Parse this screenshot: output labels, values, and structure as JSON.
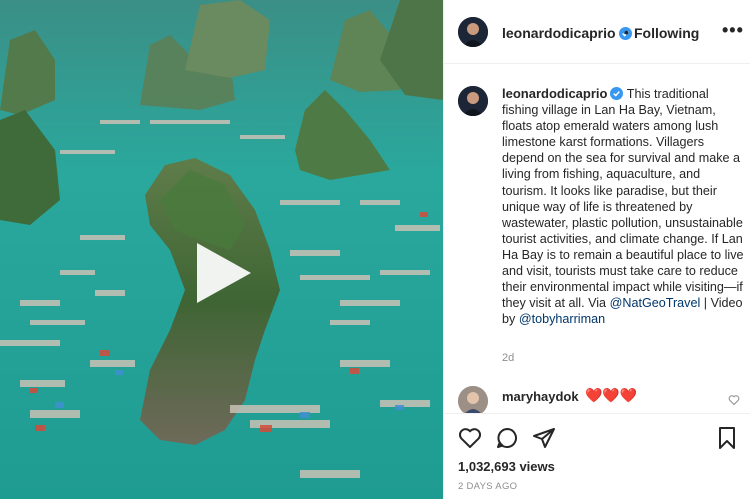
{
  "post": {
    "username": "leonardodicaprio",
    "follow_status": "Following",
    "separator": "•",
    "more_label": "•••",
    "caption": {
      "username": "leonardodicaprio",
      "text": "This traditional fishing village in Lan Ha Bay, Vietnam, floats atop emerald waters among lush limestone karst formations. Villagers depend on the sea for survival and make a living from fishing, aquaculture, and tourism. It looks like paradise, but their unique way of life is threatened by wastewater, plastic pollution, unsustainable tourist activities, and climate change. If Lan Ha Bay is to remain a beautiful place to live and visit, tourists must take care to reduce their environmental impact while visiting—if they visit at all. Via",
      "mention1": "@NatGeoTravel",
      "mid_text": " | Video by ",
      "mention2": "@tobyharriman",
      "age": "2d"
    },
    "comment": {
      "username": "maryhaydok",
      "text": "❤️❤️❤️"
    },
    "views": "1,032,693 views",
    "date": "2 DAYS AGO"
  },
  "colors": {
    "link": "#00376b",
    "verified": "#3897f0",
    "muted": "#8e8e8e",
    "water": "#2ba39a"
  },
  "icons": {
    "play": "play-icon",
    "verified": "verified-badge-icon",
    "like": "heart-icon",
    "comment": "comment-icon",
    "share": "share-icon",
    "save": "bookmark-icon"
  }
}
